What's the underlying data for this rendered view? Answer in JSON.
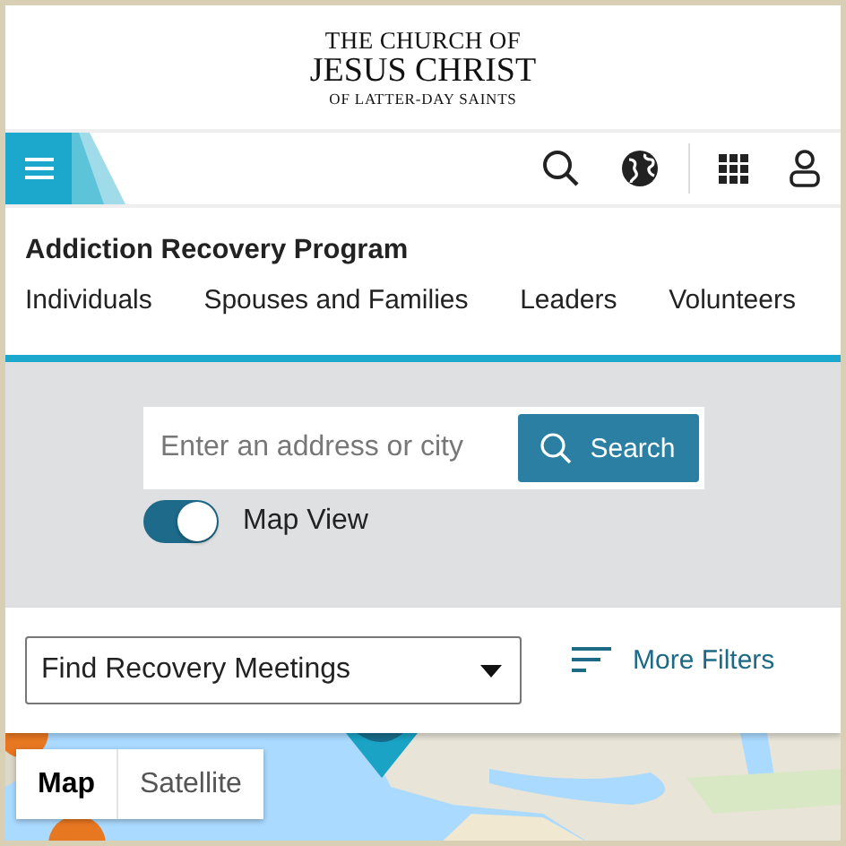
{
  "header": {
    "logo_lines": [
      "THE CHURCH OF",
      "JESUS CHRIST",
      "OF LATTER-DAY SAINTS"
    ]
  },
  "program": {
    "title": "Addiction Recovery Program",
    "links": [
      {
        "label": "Individuals"
      },
      {
        "label": "Spouses and Families"
      },
      {
        "label": "Leaders"
      },
      {
        "label": "Volunteers"
      }
    ]
  },
  "search": {
    "placeholder": "Enter an address or city",
    "button": "Search"
  },
  "map_view_toggle": {
    "label": "Map View",
    "on": true
  },
  "filters": {
    "dropdown": "Find Recovery Meetings",
    "more_filters": "More Filters"
  },
  "map": {
    "kind": "picture",
    "map_types": [
      {
        "label": "Map",
        "selected": true
      },
      {
        "label": "Satellite",
        "selected": false
      }
    ]
  }
}
